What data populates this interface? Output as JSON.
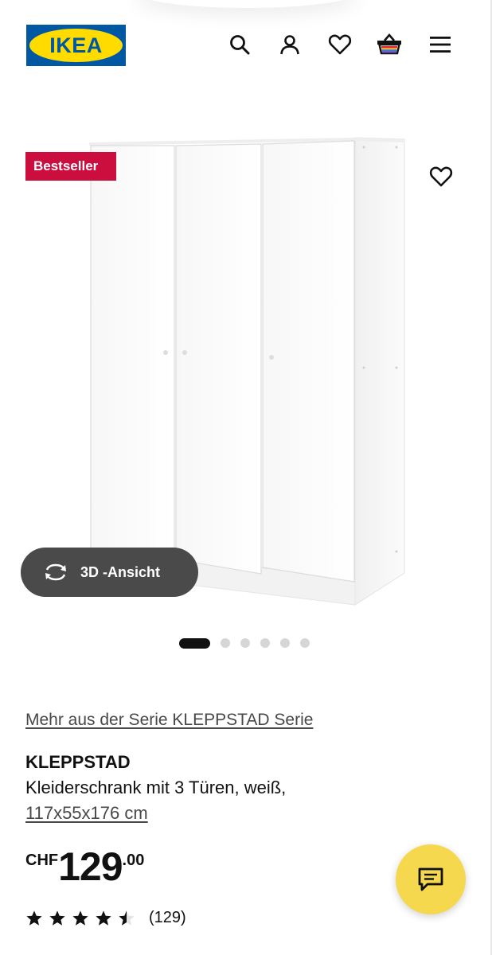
{
  "header": {
    "logo_text": "IKEA",
    "icons": [
      "search-icon",
      "user-icon",
      "heart-icon",
      "cart-icon",
      "menu-icon"
    ],
    "brand_blue": "#0058a3",
    "brand_yellow": "#ffdb00"
  },
  "product_image": {
    "badge": "Bestseller",
    "badge_color": "#cc0e3f",
    "view_3d_label": "3D -Ansicht",
    "image_count": 6,
    "active_image": 1
  },
  "product": {
    "series_link": "Mehr aus der Serie KLEPPSTAD Serie",
    "name": "KLEPPSTAD",
    "description": "Kleiderschrank mit 3 Türen, weiß,",
    "size": "117x55x176 cm",
    "price": {
      "currency": "CHF",
      "whole": "129",
      "decimal": ".00"
    },
    "rating": {
      "stars": 4.5,
      "max": 5,
      "count": "(129)"
    }
  },
  "chat": {
    "icon": "chat-icon",
    "color": "#f5d84e"
  }
}
